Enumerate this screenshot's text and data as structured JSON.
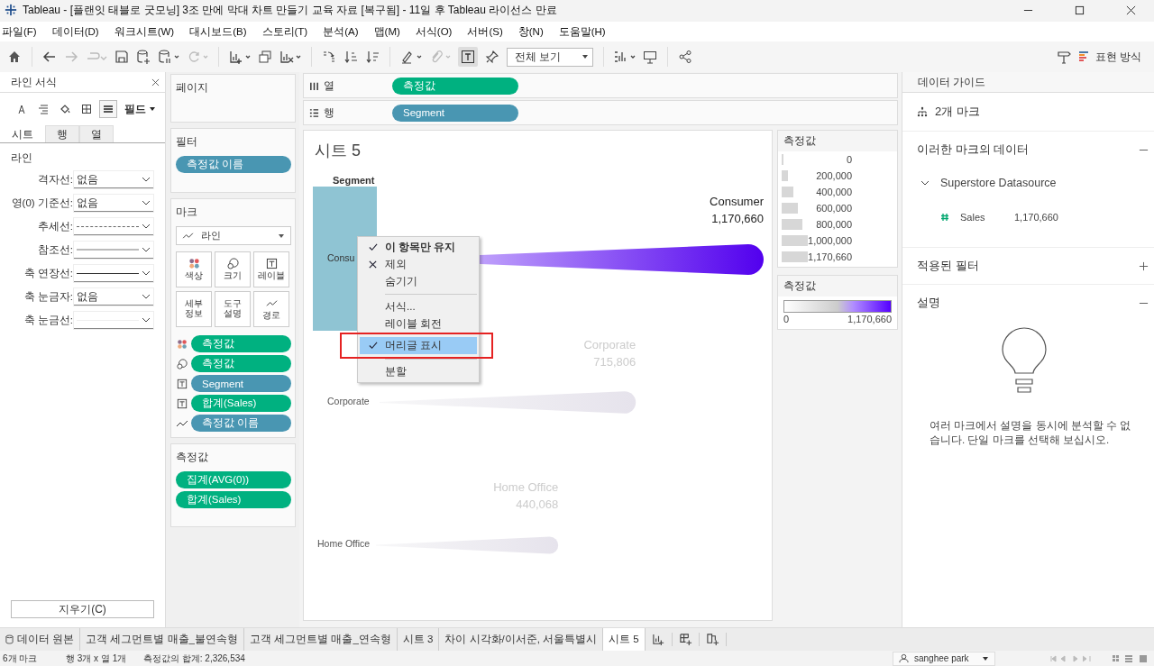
{
  "window": {
    "title": "Tableau - [플랜잇 태블로 굿모닝] 3조 만에 막대 차트 만들기 교육 자료 [복구됨] - 11일 후 Tableau 라이선스 만료"
  },
  "menu_bar": [
    "파일(F)",
    "데이터(D)",
    "워크시트(W)",
    "대시보드(B)",
    "스토리(T)",
    "분석(A)",
    "맵(M)",
    "서식(O)",
    "서버(S)",
    "창(N)",
    "도움말(H)"
  ],
  "toolbar": {
    "fit_dropdown": "전체 보기",
    "mark_labels_on": true,
    "show_me": "표현 방식"
  },
  "format_pane": {
    "title": "라인 서식",
    "tools": [
      {
        "kind": "font",
        "selected": false
      },
      {
        "kind": "align",
        "selected": false
      },
      {
        "kind": "shading",
        "selected": false
      },
      {
        "kind": "borders",
        "selected": false
      },
      {
        "kind": "lines",
        "selected": true
      }
    ],
    "field_menu": "필드",
    "tabs": [
      {
        "label": "시트",
        "selected": true
      },
      {
        "label": "행",
        "selected": false
      },
      {
        "label": "열",
        "selected": false
      }
    ],
    "section": "라인",
    "rows": [
      {
        "label": "격자선:",
        "kind": "text",
        "value": "없음"
      },
      {
        "label": "영(0) 기준선:",
        "kind": "text",
        "value": "없음"
      },
      {
        "label": "추세선:",
        "kind": "dashed"
      },
      {
        "label": "참조선:",
        "kind": "gray"
      },
      {
        "label": "축 연장선:",
        "kind": "solid"
      },
      {
        "label": "축 눈금자:",
        "kind": "text",
        "value": "없음"
      },
      {
        "label": "축 눈금선:",
        "kind": "faint"
      }
    ],
    "clear_button": "지우기(C)"
  },
  "pages_card": {
    "title": "페이지"
  },
  "filters_card": {
    "title": "필터",
    "pills": [
      {
        "label": "측정값 이름",
        "kind": "dimension"
      }
    ]
  },
  "marks_card": {
    "title": "마크",
    "mark_type": "라인",
    "buttons": [
      {
        "label": "색상",
        "kind": "color"
      },
      {
        "label": "크기",
        "kind": "size"
      },
      {
        "label": "레이블",
        "kind": "label"
      },
      {
        "label": "세부 정보",
        "kind": "detail"
      },
      {
        "label": "도구 설명",
        "kind": "tooltip"
      },
      {
        "label": "경로",
        "kind": "path"
      }
    ],
    "encodings": [
      {
        "kind": "color",
        "pill": {
          "label": "측정값",
          "kind": "measure"
        }
      },
      {
        "kind": "size",
        "pill": {
          "label": "측정값",
          "kind": "measure"
        }
      },
      {
        "kind": "label",
        "pill": {
          "label": "Segment",
          "kind": "dimension"
        }
      },
      {
        "kind": "label",
        "pill": {
          "label": "합계(Sales)",
          "kind": "measure"
        }
      },
      {
        "kind": "path",
        "pill": {
          "label": "측정값 이름",
          "kind": "dimension"
        }
      }
    ]
  },
  "measure_values_card": {
    "title": "측정값",
    "pills": [
      {
        "label": "집계(AVG(0))",
        "kind": "measure"
      },
      {
        "label": "합계(Sales)",
        "kind": "measure"
      }
    ]
  },
  "shelves": [
    {
      "name": "열",
      "kind": "columns",
      "pills": [
        {
          "label": "측정값",
          "kind": "measure"
        }
      ]
    },
    {
      "name": "행",
      "kind": "rows",
      "pills": [
        {
          "label": "Segment",
          "kind": "dimension"
        }
      ]
    }
  ],
  "view": {
    "title": "시트 5",
    "header": "Segment",
    "rows": [
      {
        "label": "Consu",
        "selected": true,
        "mark_label": "Consumer",
        "mark_value": "1,170,660"
      },
      {
        "label": "Corporate",
        "selected": false,
        "mark_label": "Corporate",
        "mark_value": "715,806"
      },
      {
        "label": "Home Office",
        "selected": false,
        "mark_label": "Home Office",
        "mark_value": "440,068"
      }
    ]
  },
  "context_menu": [
    {
      "kind": "check",
      "label": "이 항목만 유지",
      "bold": true,
      "selected": false
    },
    {
      "kind": "cross",
      "label": "제외",
      "bold": false,
      "selected": false
    },
    {
      "kind": "item",
      "label": "숨기기",
      "bold": false,
      "selected": false
    },
    {
      "kind": "separator"
    },
    {
      "kind": "item",
      "label": "서식...",
      "bold": false,
      "selected": false
    },
    {
      "kind": "item",
      "label": "레이블 회전",
      "bold": false,
      "selected": false
    },
    {
      "kind": "check",
      "label": "머리글 표시",
      "bold": false,
      "selected": true
    },
    {
      "kind": "separator"
    },
    {
      "kind": "item",
      "label": "분할",
      "bold": false,
      "selected": false
    }
  ],
  "legends": [
    {
      "kind": "size",
      "title": "측정값",
      "items": [
        "0",
        "200,000",
        "400,000",
        "600,000",
        "800,000",
        "1,000,000",
        "1,170,660"
      ]
    },
    {
      "kind": "color",
      "title": "측정값",
      "min": "0",
      "max": "1,170,660"
    }
  ],
  "data_guide": {
    "title": "데이터 가이드",
    "marks": "2개 마크",
    "sections": [
      {
        "kind": "data",
        "title": "이러한 마크의 데이터",
        "expanded": true,
        "source": "Superstore Datasource",
        "fields": [
          {
            "name": "Sales",
            "value": "1,170,660"
          }
        ]
      },
      {
        "title": "적용된 필터",
        "expanded": false
      },
      {
        "kind": "explain",
        "title": "설명",
        "expanded": true,
        "message": "여러 마크에서 설명을 동시에 분석할 수 없습니다. 단일 마크를 선택해 보십시오."
      }
    ]
  },
  "sheet_tabs": [
    {
      "label": "데이터 원본",
      "kind": "datasource",
      "selected": false
    },
    {
      "label": "고객 세그먼트별 매출_불연속형",
      "kind": "sheet",
      "selected": false
    },
    {
      "label": "고객 세그먼트별 매출_연속형",
      "kind": "sheet",
      "selected": false
    },
    {
      "label": "시트 3",
      "kind": "sheet",
      "selected": false
    },
    {
      "label": "차이 시각화/이서준, 서울특별시",
      "kind": "sheet",
      "selected": false
    },
    {
      "label": "시트 5",
      "kind": "sheet",
      "selected": true
    }
  ],
  "status_bar": {
    "marks": "6개 마크",
    "dims": "행 3개  x  열 1개",
    "sum": "측정값의 합계: 2,326,534",
    "user": "sanghee park"
  }
}
